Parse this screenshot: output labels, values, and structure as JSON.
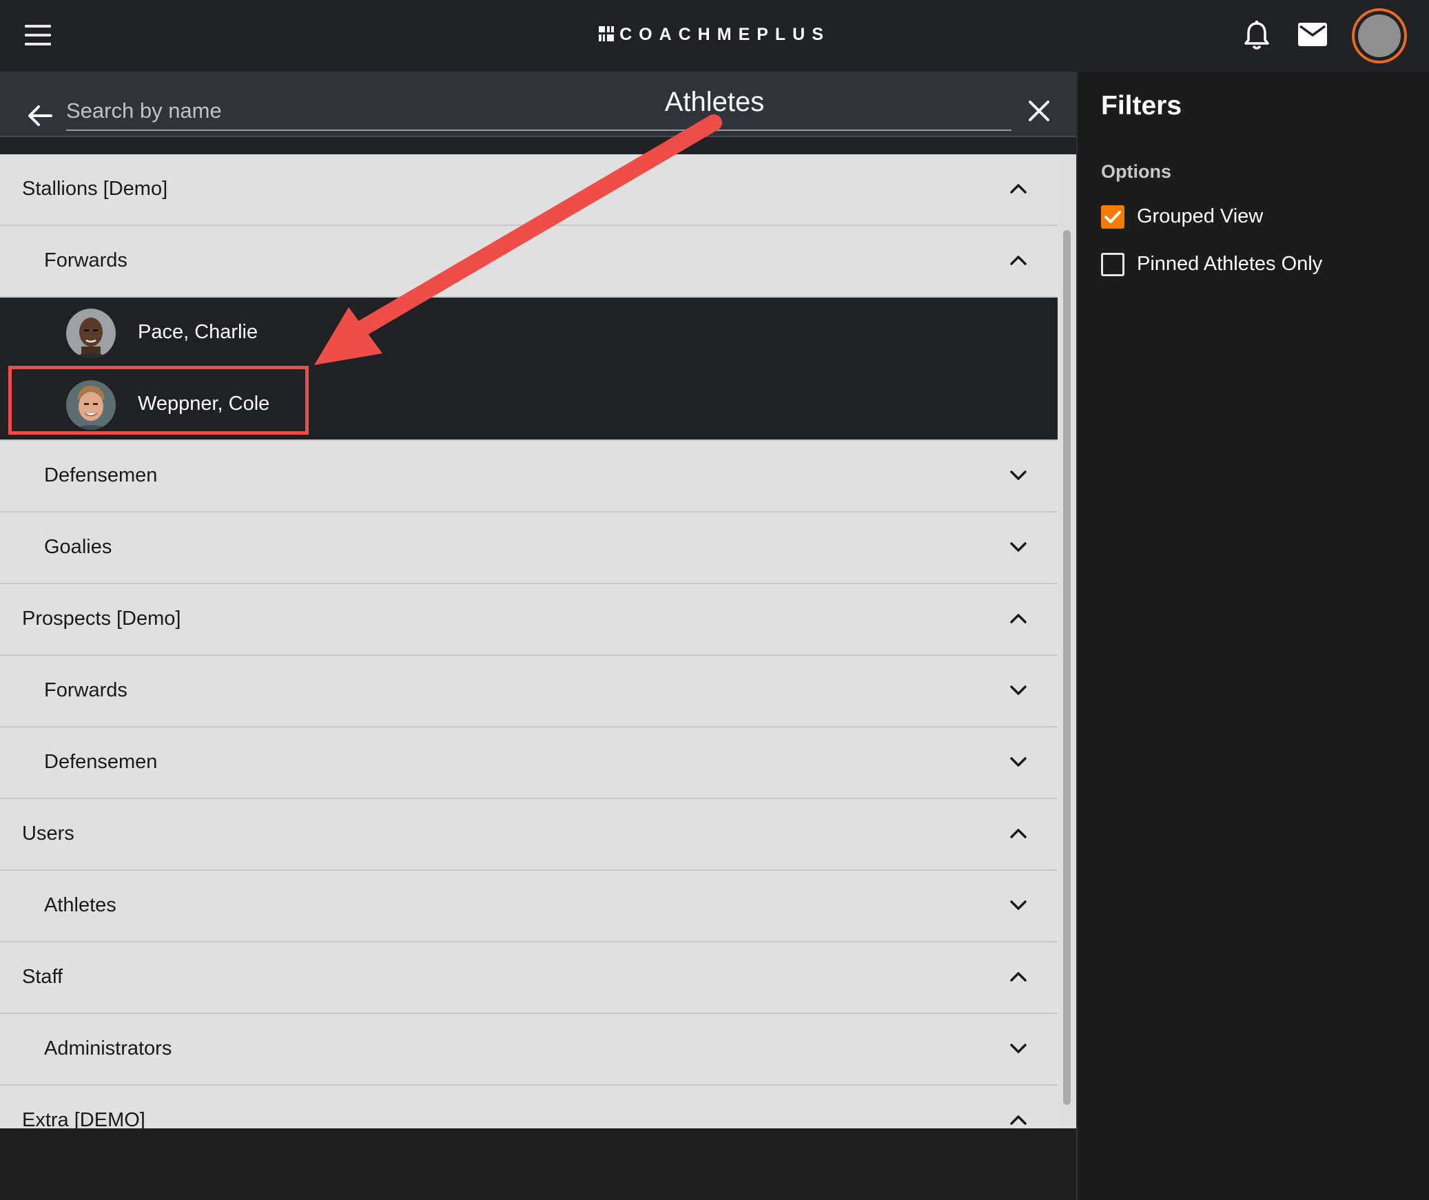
{
  "header": {
    "brand": "COACHMEPLUS",
    "icons": [
      "menu-icon",
      "bell-icon",
      "mail-icon",
      "avatar"
    ]
  },
  "main": {
    "title": "Athletes",
    "search": {
      "placeholder": "Search by name",
      "value": ""
    }
  },
  "groups": {
    "stallions": {
      "label": "Stallions [Demo]",
      "state": "expanded"
    },
    "stallions_forwards": {
      "label": "Forwards",
      "state": "expanded"
    },
    "athletes": [
      {
        "name": "Pace, Charlie"
      },
      {
        "name": "Weppner, Cole"
      }
    ],
    "stallions_defensemen": {
      "label": "Defensemen",
      "state": "collapsed"
    },
    "stallions_goalies": {
      "label": "Goalies",
      "state": "collapsed"
    },
    "prospects": {
      "label": "Prospects [Demo]",
      "state": "expanded"
    },
    "prospects_forwards": {
      "label": "Forwards",
      "state": "collapsed"
    },
    "prospects_defensemen": {
      "label": "Defensemen",
      "state": "collapsed"
    },
    "users": {
      "label": "Users",
      "state": "expanded"
    },
    "users_athletes": {
      "label": "Athletes",
      "state": "collapsed"
    },
    "staff": {
      "label": "Staff",
      "state": "expanded"
    },
    "staff_administrators": {
      "label": "Administrators",
      "state": "collapsed"
    },
    "extra": {
      "label": "Extra [DEMO]",
      "state": "expanded"
    }
  },
  "filters": {
    "title": "Filters",
    "section": "Options",
    "grouped_view": {
      "label": "Grouped View",
      "checked": true
    },
    "pinned_only": {
      "label": "Pinned Athletes Only",
      "checked": false
    }
  },
  "colors": {
    "accent": "#f57c00",
    "annotation": "#ef4d47",
    "topbar": "#202124",
    "list_bg": "#e0e0e0"
  }
}
